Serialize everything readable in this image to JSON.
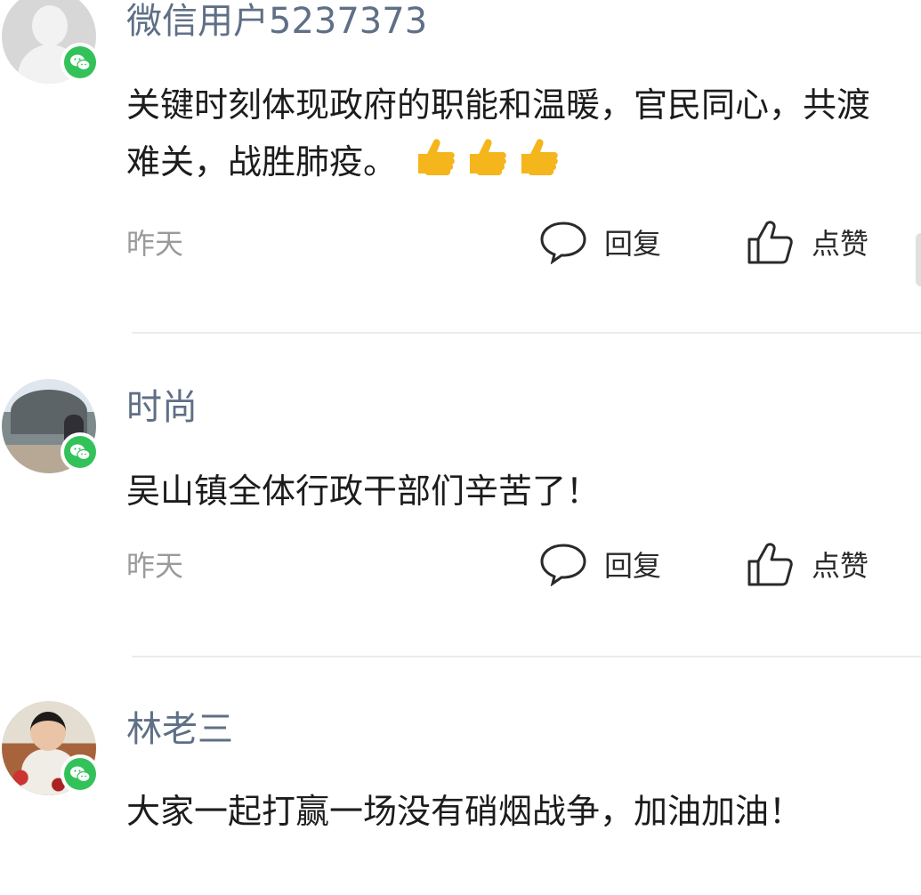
{
  "comments": [
    {
      "name": "微信用户5237373",
      "text": "关键时刻体现政府的职能和温暖，官民同心，共渡难关，战胜肺疫。",
      "emoji_count": 3,
      "time": "昨天",
      "reply_label": "回复",
      "like_label": "点赞"
    },
    {
      "name": "时尚",
      "text": "吴山镇全体行政干部们辛苦了！",
      "time": "昨天",
      "reply_label": "回复",
      "like_label": "点赞"
    },
    {
      "name": "林老三",
      "text": "大家一起打赢一场没有硝烟战争，加油加油！"
    }
  ],
  "colors": {
    "badge": "#33c25a",
    "name": "#5f6f86",
    "time": "#9a9a9a",
    "emoji": "#f5b51c"
  },
  "icons": [
    "wechat-badge-icon",
    "reply-bubble-icon",
    "thumbs-up-outline-icon",
    "thumbs-up-emoji-icon"
  ]
}
